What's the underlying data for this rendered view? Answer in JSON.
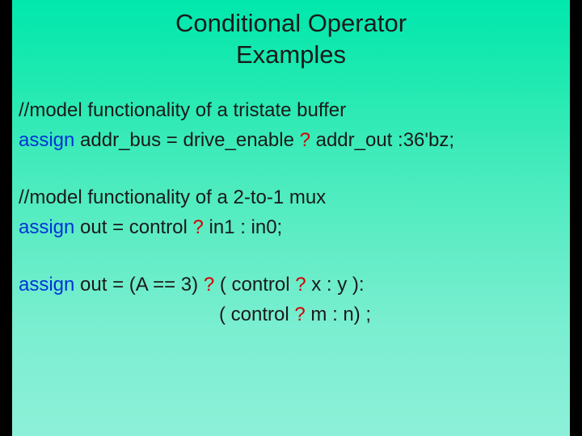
{
  "title_line1": "Conditional Operator",
  "title_line2": "Examples",
  "l1_comment": "//model functionality of a tristate buffer",
  "l2_kw": "assign",
  "l2_a": " addr_bus = drive_enable ",
  "l2_q": "?",
  "l2_b": " addr_out :36'bz;",
  "l3_comment": "//model functionality of a 2-to-1 mux",
  "l4_kw": "assign",
  "l4_a": " out = control ",
  "l4_q": "?",
  "l4_b": " in1 : in0;",
  "l5_kw": "assign",
  "l5_a": " out = (A == 3) ",
  "l5_q1": "?",
  "l5_b": " ( control ",
  "l5_q2": "?",
  "l5_c": " x : y ):",
  "l6_a": "( control ",
  "l6_q": "?",
  "l6_b": " m : n) ;"
}
